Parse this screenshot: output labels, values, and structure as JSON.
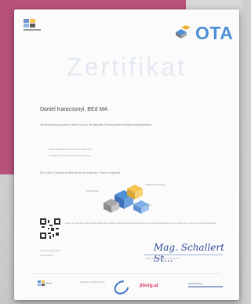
{
  "document": {
    "brand": "OTA",
    "title": "Zertifikat",
    "recipient": "Daniel Karacsonyi, BEd MA",
    "intro": "hat die Ausbildung zum/zur Online-Tutor_in mit folgenden Schwerpunkten erfolgreich abgeschlossen:",
    "bullets": [
      "Präsenzveranstaltungen und Online-Phase (Mt)",
      "Praxisfächer und Onlineveranstaltungen (Geh.)"
    ],
    "para2": "Das Online-Coaching-Ausbildung wird auf folgenden Themen umgesetzt:",
    "diagram_labels": [
      "Online-Phase",
      "Präsenzveranstaltung",
      "Praxis"
    ],
    "qr_text": "Durch den QR-Code finden Sie die Inhalte der Ausbildung nachvollziehbar, Kompetenzen und weitere Informationen zu den Online-Tutor_innen und Coaching-Projekten.",
    "place_date": "Innsbruck, 20.10.2019",
    "place_label": "Ort und Datum",
    "signature": "Mag. Schallert St...",
    "signer": "Mag. Stefanie Schallert, Leitung OTA",
    "footer": {
      "partner1": "Akademie Ländlicher Raum",
      "partner2": "jiburg.at",
      "partner3": "ERASMUS+"
    }
  }
}
